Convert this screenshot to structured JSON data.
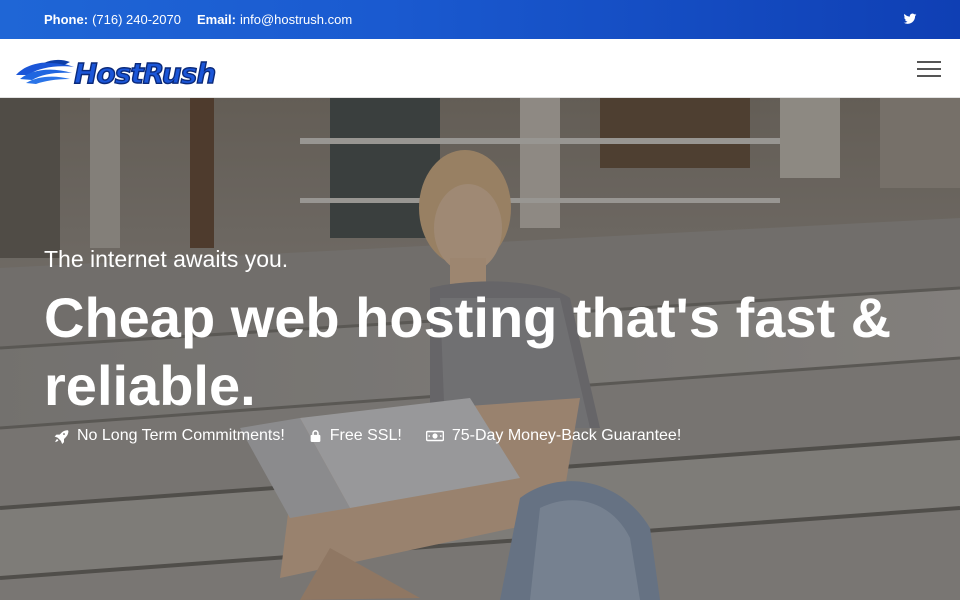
{
  "topbar": {
    "phone_label": "Phone:",
    "phone_value": "(716) 240-2070",
    "email_label": "Email:",
    "email_value": "info@hostrush.com",
    "social_icon": "twitter-icon"
  },
  "navbar": {
    "logo_text": "HostRush",
    "menu_icon": "hamburger-menu-icon"
  },
  "hero": {
    "subtitle": "The internet awaits you.",
    "title": "Cheap web hosting that's fast & reliable.",
    "features": [
      {
        "icon": "rocket-icon",
        "label": "No Long Term Commitments!"
      },
      {
        "icon": "lock-icon",
        "label": "Free SSL!"
      },
      {
        "icon": "money-icon",
        "label": "75-Day Money-Back Guarantee!"
      }
    ]
  },
  "colors": {
    "topbar_blue": "#1a5ad0",
    "logo_blue": "#1b56d8",
    "text_white": "#ffffff"
  }
}
